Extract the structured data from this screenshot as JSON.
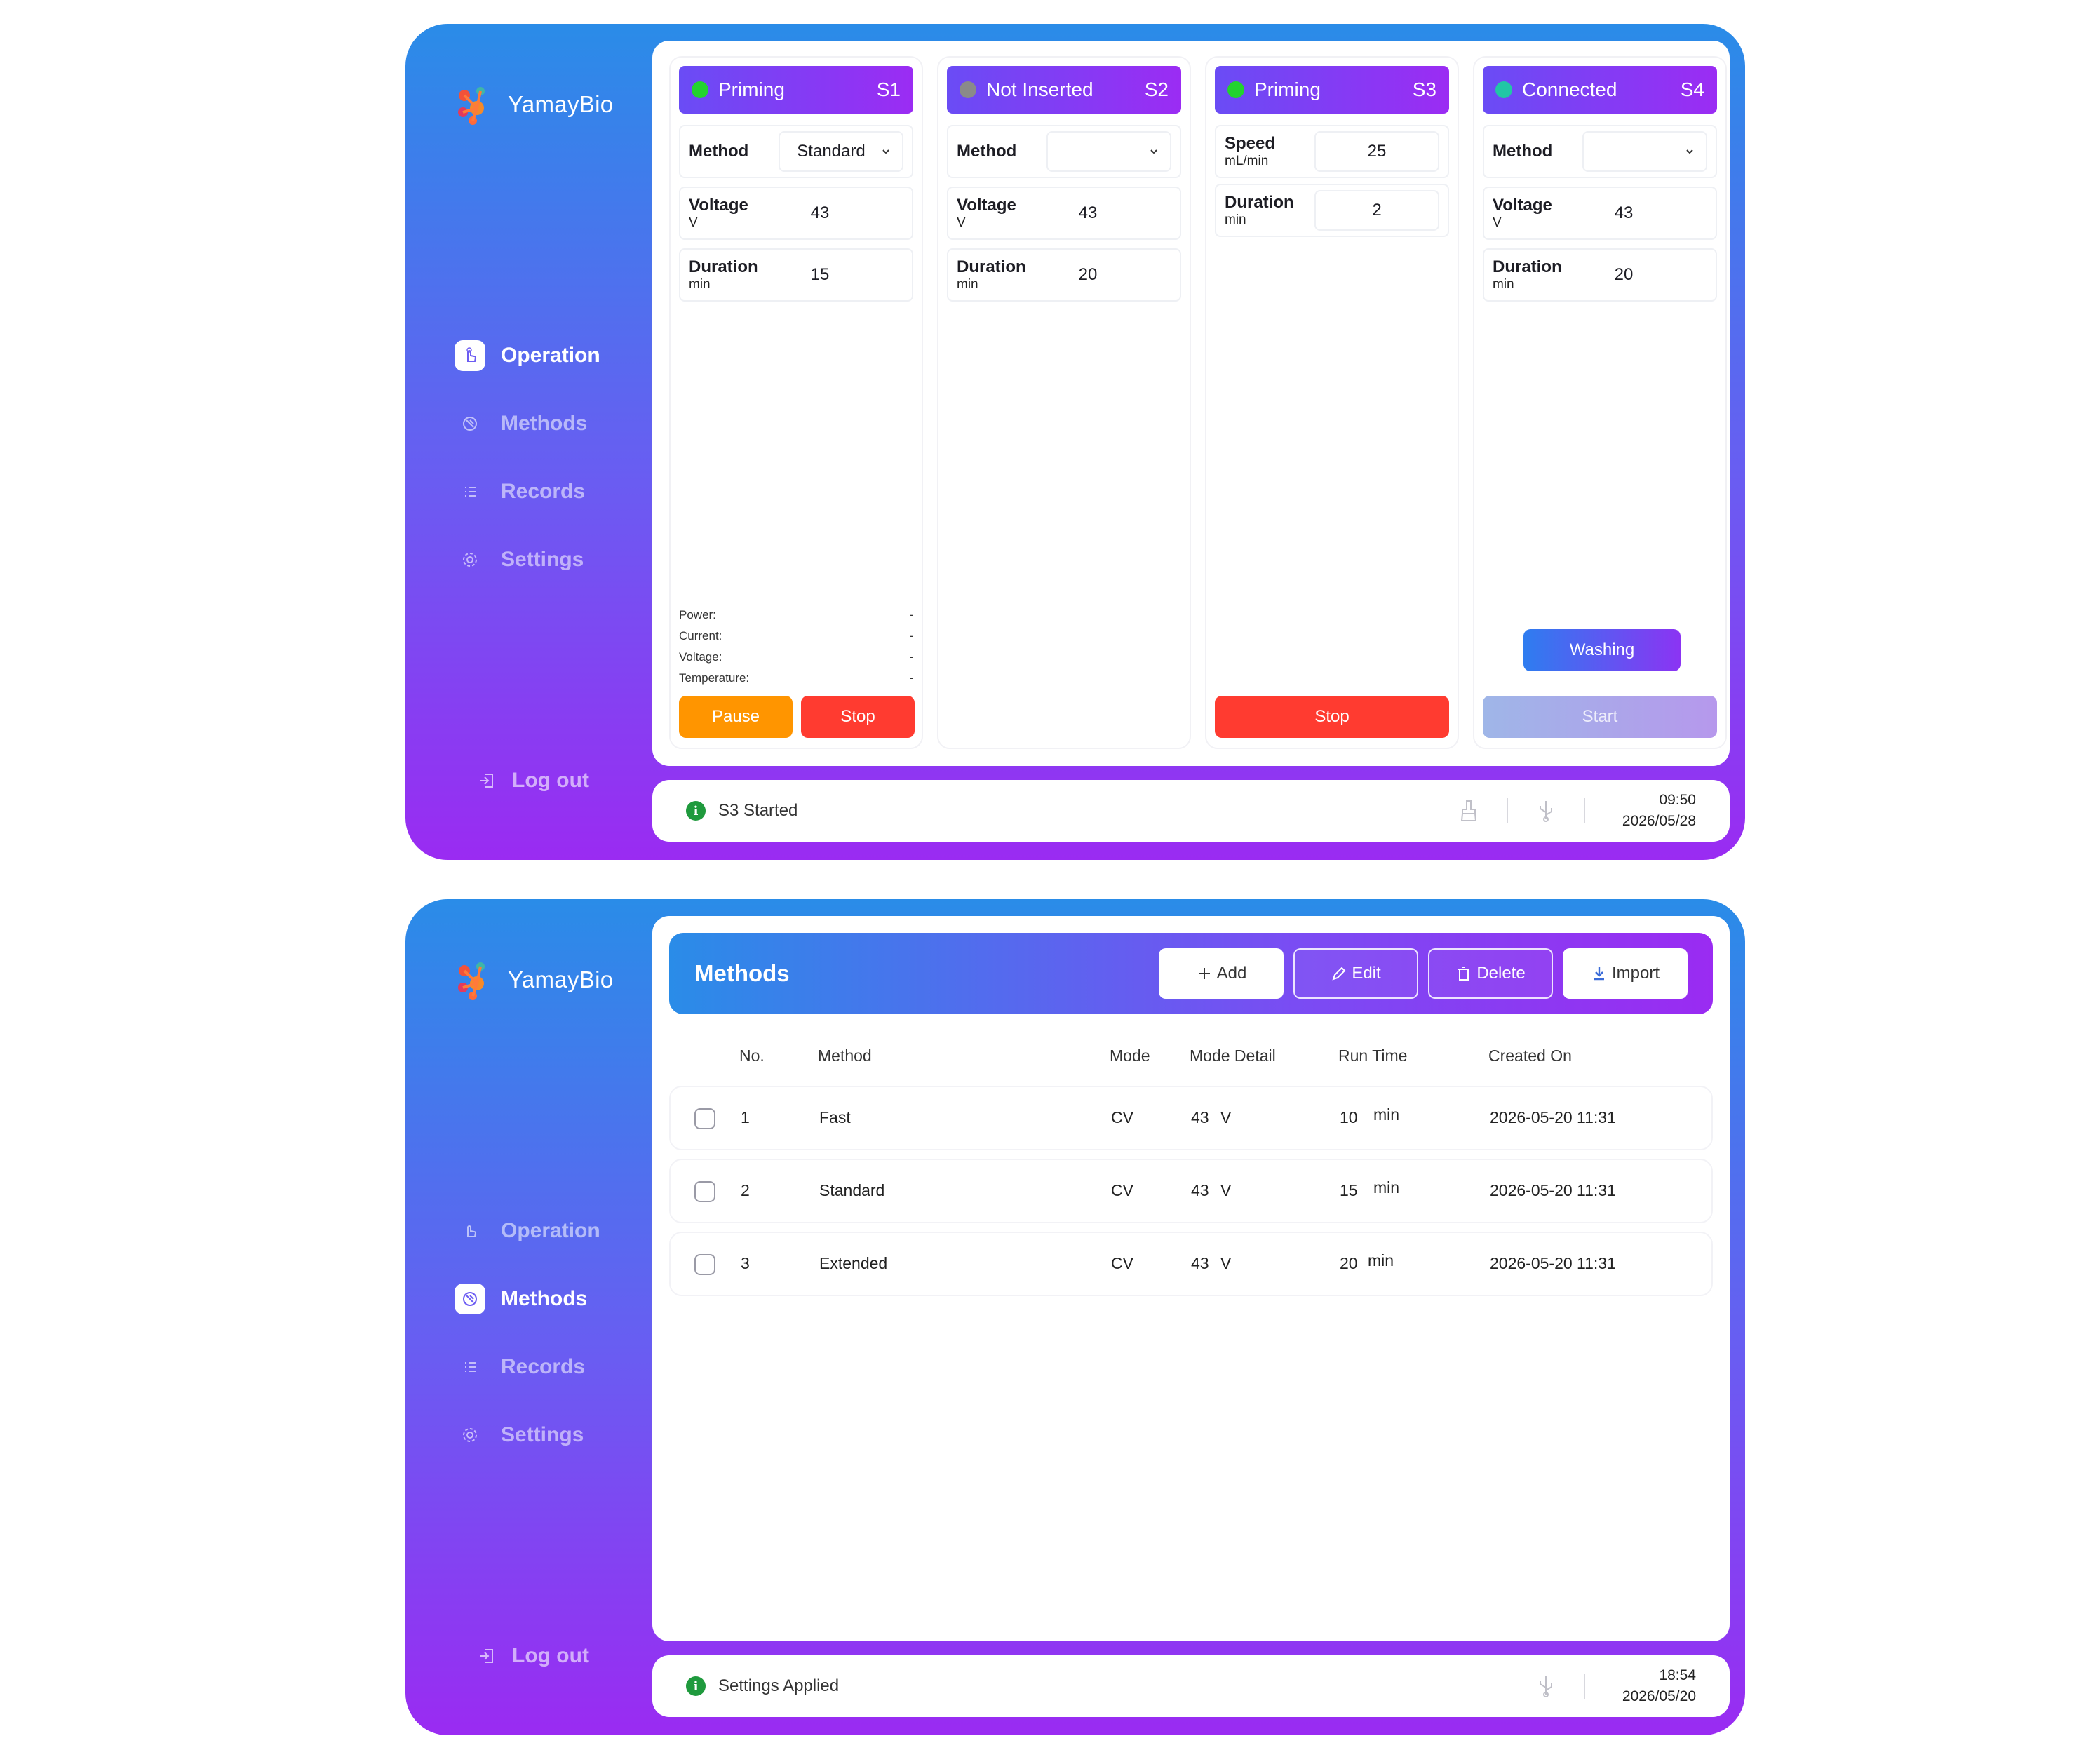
{
  "brand": {
    "name": "YamayBio"
  },
  "nav": {
    "items": [
      {
        "label": "Operation",
        "icon": "hand-pointer-icon"
      },
      {
        "label": "Methods",
        "icon": "methods-icon"
      },
      {
        "label": "Records",
        "icon": "list-icon"
      },
      {
        "label": "Settings",
        "icon": "gear-icon"
      }
    ],
    "logout": "Log out"
  },
  "screen1": {
    "active_nav": "Operation",
    "slots": [
      {
        "state": "Priming",
        "id": "S1",
        "dot_color": "#22d32e",
        "rows": [
          {
            "label": "Method",
            "unit": "",
            "value": "Standard",
            "kind": "select"
          },
          {
            "label": "Voltage",
            "unit": "V",
            "value": "43",
            "kind": "value"
          },
          {
            "label": "Duration",
            "unit": "min",
            "value": "15",
            "kind": "value"
          }
        ],
        "readings": [
          {
            "label": "Power:",
            "value": "-"
          },
          {
            "label": "Current:",
            "value": "-"
          },
          {
            "label": "Voltage:",
            "value": "-"
          },
          {
            "label": "Temperature:",
            "value": "-"
          }
        ],
        "buttons": [
          {
            "label": "Pause"
          },
          {
            "label": "Stop"
          }
        ]
      },
      {
        "state": "Not Inserted",
        "id": "S2",
        "dot_color": "#8a8a8a",
        "rows": [
          {
            "label": "Method",
            "unit": "",
            "value": "",
            "kind": "select"
          },
          {
            "label": "Voltage",
            "unit": "V",
            "value": "43",
            "kind": "value"
          },
          {
            "label": "Duration",
            "unit": "min",
            "value": "20",
            "kind": "value"
          }
        ]
      },
      {
        "state": "Priming",
        "id": "S3",
        "dot_color": "#22d32e",
        "rows": [
          {
            "label": "Speed",
            "unit": "mL/min",
            "value": "25",
            "kind": "box"
          },
          {
            "label": "Duration",
            "unit": "min",
            "value": "2",
            "kind": "box"
          }
        ],
        "buttons": [
          {
            "label": "Stop"
          }
        ]
      },
      {
        "state": "Connected",
        "id": "S4",
        "dot_color": "#21c6a6",
        "rows": [
          {
            "label": "Method",
            "unit": "",
            "value": "",
            "kind": "select"
          },
          {
            "label": "Voltage",
            "unit": "V",
            "value": "43",
            "kind": "value"
          },
          {
            "label": "Duration",
            "unit": "min",
            "value": "20",
            "kind": "value"
          }
        ],
        "buttons": [
          {
            "label": "Washing"
          },
          {
            "label": "Start"
          }
        ]
      }
    ],
    "status": {
      "message": "S3 Started",
      "time": "09:50",
      "date": "2026/05/28"
    }
  },
  "screen2": {
    "active_nav": "Methods",
    "title": "Methods",
    "actions": [
      {
        "label": "Add",
        "icon": "plus-icon"
      },
      {
        "label": "Edit",
        "icon": "pencil-icon"
      },
      {
        "label": "Delete",
        "icon": "trash-icon"
      },
      {
        "label": "Import",
        "icon": "download-icon"
      }
    ],
    "columns": [
      "No.",
      "Method",
      "Mode",
      "Mode Detail",
      "Run Time",
      "Created On"
    ],
    "rows": [
      {
        "no": "1",
        "method": "Fast",
        "mode": "CV",
        "detail_value": "43",
        "detail_unit": "V",
        "run_value": "10",
        "run_unit": "min",
        "created": "2026-05-20 11:31"
      },
      {
        "no": "2",
        "method": "Standard",
        "mode": "CV",
        "detail_value": "43",
        "detail_unit": "V",
        "run_value": "15",
        "run_unit": "min",
        "created": "2026-05-20 11:31"
      },
      {
        "no": "3",
        "method": "Extended",
        "mode": "CV",
        "detail_value": "43",
        "detail_unit": "V",
        "run_value": "20",
        "run_unit": "min",
        "created": "2026-05-20 11:31"
      }
    ],
    "status": {
      "message": "Settings Applied",
      "time": "18:54",
      "date": "2026/05/20"
    }
  }
}
